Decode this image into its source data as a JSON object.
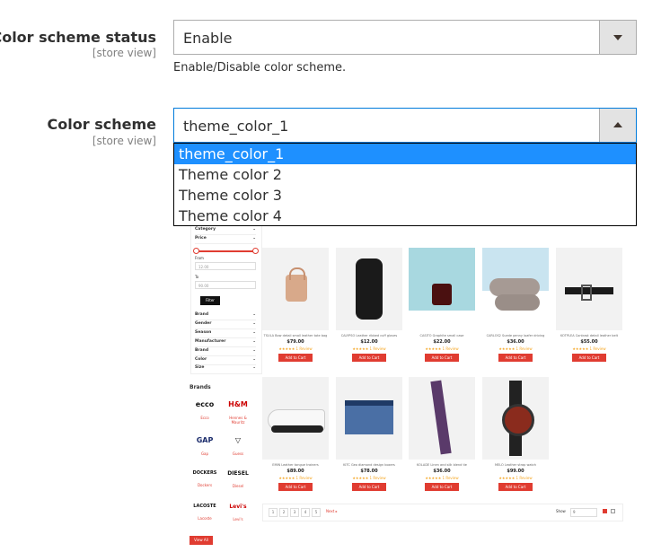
{
  "fields": {
    "status": {
      "label": "Color scheme status",
      "scope": "[store view]",
      "value": "Enable",
      "note": "Enable/Disable color scheme."
    },
    "scheme": {
      "label": "Color scheme",
      "scope": "[store view]",
      "value": "theme_color_1",
      "options": [
        "theme_color_1",
        "Theme color 2",
        "Theme color 3",
        "Theme color 4"
      ],
      "selected_index": 0
    }
  },
  "preview": {
    "sidebar": {
      "category": "Category",
      "price": "Price",
      "from_label": "From",
      "from_value": "12.00",
      "to_label": "To",
      "to_value": "90.00",
      "filter": "Filter",
      "filters": [
        "Brand",
        "Gender",
        "Season",
        "Manufacturer",
        "Brand",
        "Color",
        "Size"
      ],
      "chev": "⌄"
    },
    "brands": {
      "title": "Brands",
      "items": [
        {
          "logo": "ecco",
          "name": "Ecco"
        },
        {
          "logo": "H&M",
          "name": "Hennes & Mauritz"
        },
        {
          "logo": "GAP",
          "name": "Gap"
        },
        {
          "logo": "▽",
          "name": "Guess"
        },
        {
          "logo": "DOCKERS",
          "name": "Dockers"
        },
        {
          "logo": "DIESEL",
          "name": "Diesel"
        },
        {
          "logo": "LACOSTE",
          "name": "Lacoste"
        },
        {
          "logo": "Levi's",
          "name": "Levi's"
        }
      ],
      "view_all": "View All"
    },
    "cart_label": "Add to Cart",
    "stars": "★★★★★ 1 Review",
    "products": [
      {
        "name": "TSULA Bow detail small leather tote bag",
        "price": "$79.00",
        "bg": "#f2f2f2",
        "item": "bag"
      },
      {
        "name": "CALYPSO Leather ribbed cuff gloves",
        "price": "$12.00",
        "bg": "#f2f2f2",
        "item": "glove"
      },
      {
        "name": "CASITO Graphite small case",
        "price": "$22.00",
        "bg": "#a8d8e0",
        "item": "case"
      },
      {
        "name": "CARLOS2 Suede penny loafer driving",
        "price": "$36.00",
        "bg": "#c9e4f0",
        "item": "loafer"
      },
      {
        "name": "KOTPLEA Contrast detail leather belt",
        "price": "$55.00",
        "bg": "#f2f2f2",
        "item": "belt"
      },
      {
        "name": "EMIN Leather tongue trainers",
        "price": "$89.00",
        "bg": "#f2f2f2",
        "item": "sneaker"
      },
      {
        "name": "KITC Geo diamond design boxers",
        "price": "$78.00",
        "bg": "#f2f2f2",
        "item": "boxers"
      },
      {
        "name": "KOLADE Linen and silk blend tie",
        "price": "$36.00",
        "bg": "#f2f2f2",
        "item": "tie"
      },
      {
        "name": "MELO Leather strap watch",
        "price": "$99.00",
        "bg": "#f2f2f2",
        "item": "watch"
      }
    ],
    "pager": {
      "pages": [
        "1",
        "2",
        "3",
        "4",
        "5"
      ],
      "next": "Next ▸",
      "show_label": "Show",
      "show_value": "9"
    }
  }
}
